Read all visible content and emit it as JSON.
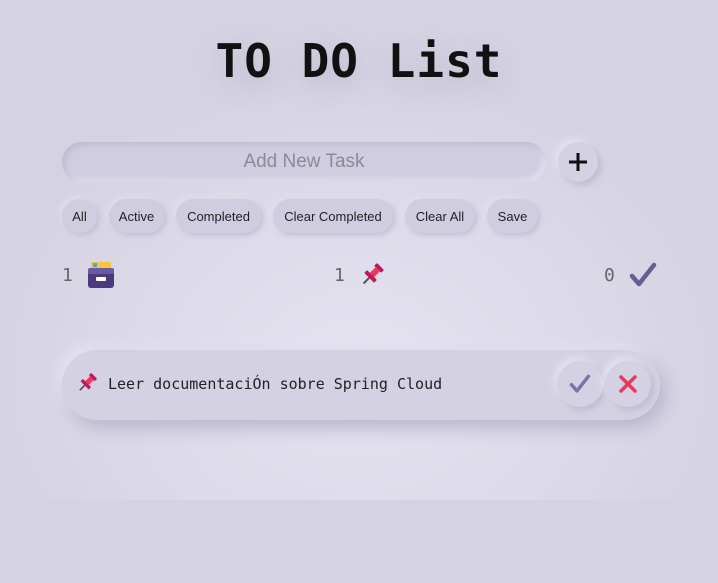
{
  "header": {
    "title": "TO DO List"
  },
  "add_task": {
    "placeholder": "Add New Task",
    "button_icon": "plus-icon"
  },
  "filters": [
    {
      "label": "All"
    },
    {
      "label": "Active"
    },
    {
      "label": "Completed"
    },
    {
      "label": "Clear Completed"
    },
    {
      "label": "Clear All"
    },
    {
      "label": "Save"
    }
  ],
  "stats": {
    "total": {
      "count": "1",
      "icon": "card-file-box-icon"
    },
    "active": {
      "count": "1",
      "icon": "pushpin-icon"
    },
    "completed": {
      "count": "0",
      "icon": "check-mark-icon"
    }
  },
  "tasks": [
    {
      "text": "Leer documentaciÓn sobre Spring Cloud",
      "icon": "pushpin-icon"
    }
  ],
  "colors": {
    "background": "#d5d2e2",
    "check": "#6b5b95",
    "delete": "#e8385f",
    "pin": "#e8385f"
  }
}
